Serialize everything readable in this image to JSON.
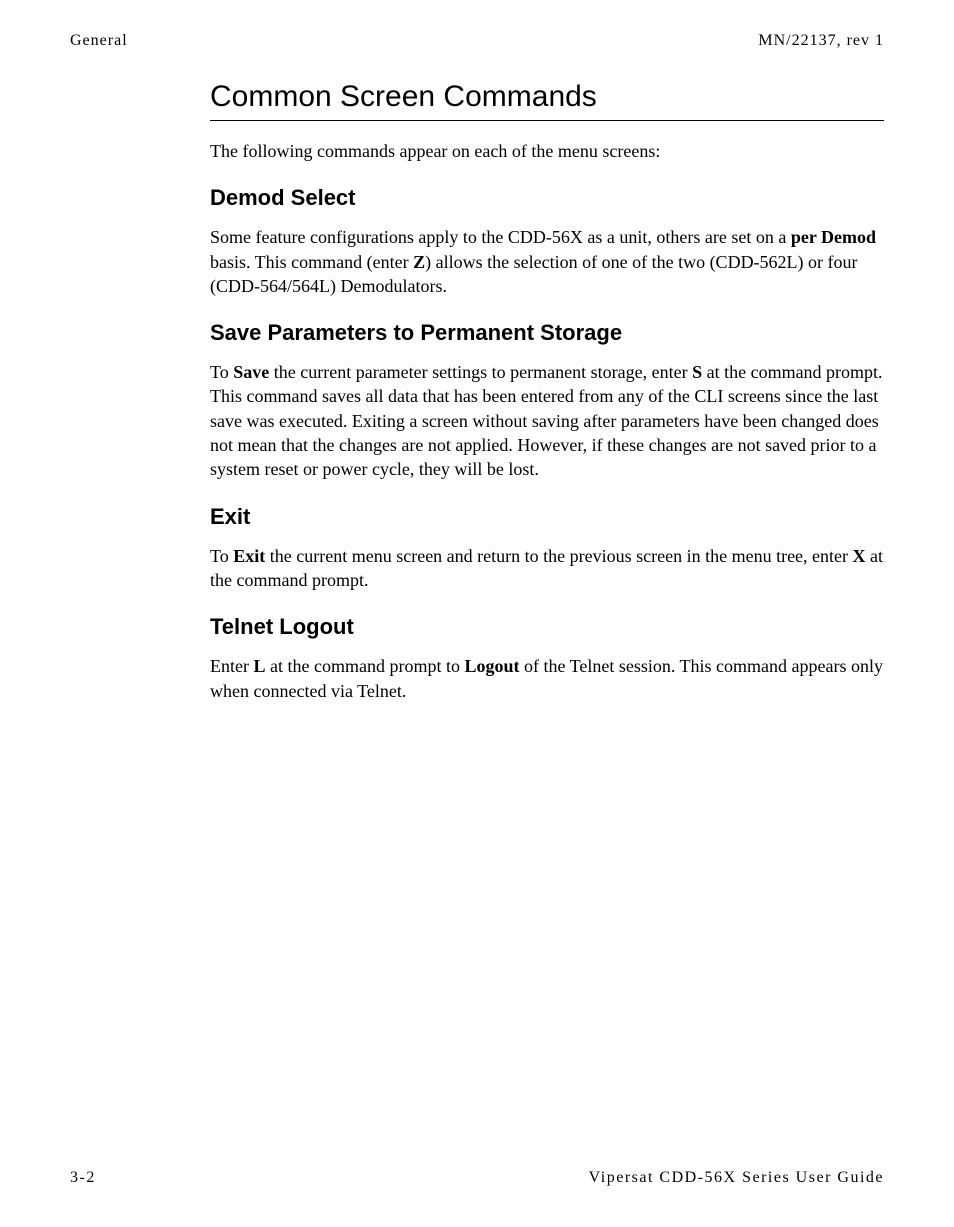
{
  "header": {
    "left": "General",
    "right": "MN/22137, rev 1"
  },
  "sections": {
    "title": "Common Screen Commands",
    "intro": "The following commands appear on each of the menu screens:",
    "demod": {
      "heading": "Demod Select",
      "p1_prefix": "Some feature configurations apply to the CDD-56X as a unit, others are set on a ",
      "p1_bold1": "per Demod",
      "p1_mid1": " basis. This command (enter ",
      "p1_bold2": "Z",
      "p1_suffix": ") allows the selection of one of the two (CDD-562L) or four (CDD-564/564L) Demodulators."
    },
    "save": {
      "heading": "Save Parameters to Permanent Storage",
      "p1_prefix": "To ",
      "p1_bold1": "Save",
      "p1_mid1": " the current parameter settings to permanent storage, enter ",
      "p1_bold2": "S",
      "p1_suffix": " at the command prompt. This command saves all data that has been entered from any of the CLI screens since the last save was executed. Exiting a screen without saving after parameters have been changed does not mean that the changes are not applied. However, if these changes are not saved prior to a system reset or power cycle, they will be lost."
    },
    "exit": {
      "heading": "Exit",
      "p1_prefix": "To ",
      "p1_bold1": "Exit",
      "p1_mid1": " the current menu screen and return to the previous screen in the menu tree, enter ",
      "p1_bold2": "X",
      "p1_suffix": " at the command prompt."
    },
    "telnet": {
      "heading": "Telnet Logout",
      "p1_prefix": "Enter ",
      "p1_bold1": "L",
      "p1_mid1": " at the command prompt to ",
      "p1_bold2": "Logout",
      "p1_suffix": " of the Telnet session. This command appears only when connected via Telnet."
    }
  },
  "footer": {
    "left": "3-2",
    "right": "Vipersat CDD-56X Series User Guide"
  }
}
